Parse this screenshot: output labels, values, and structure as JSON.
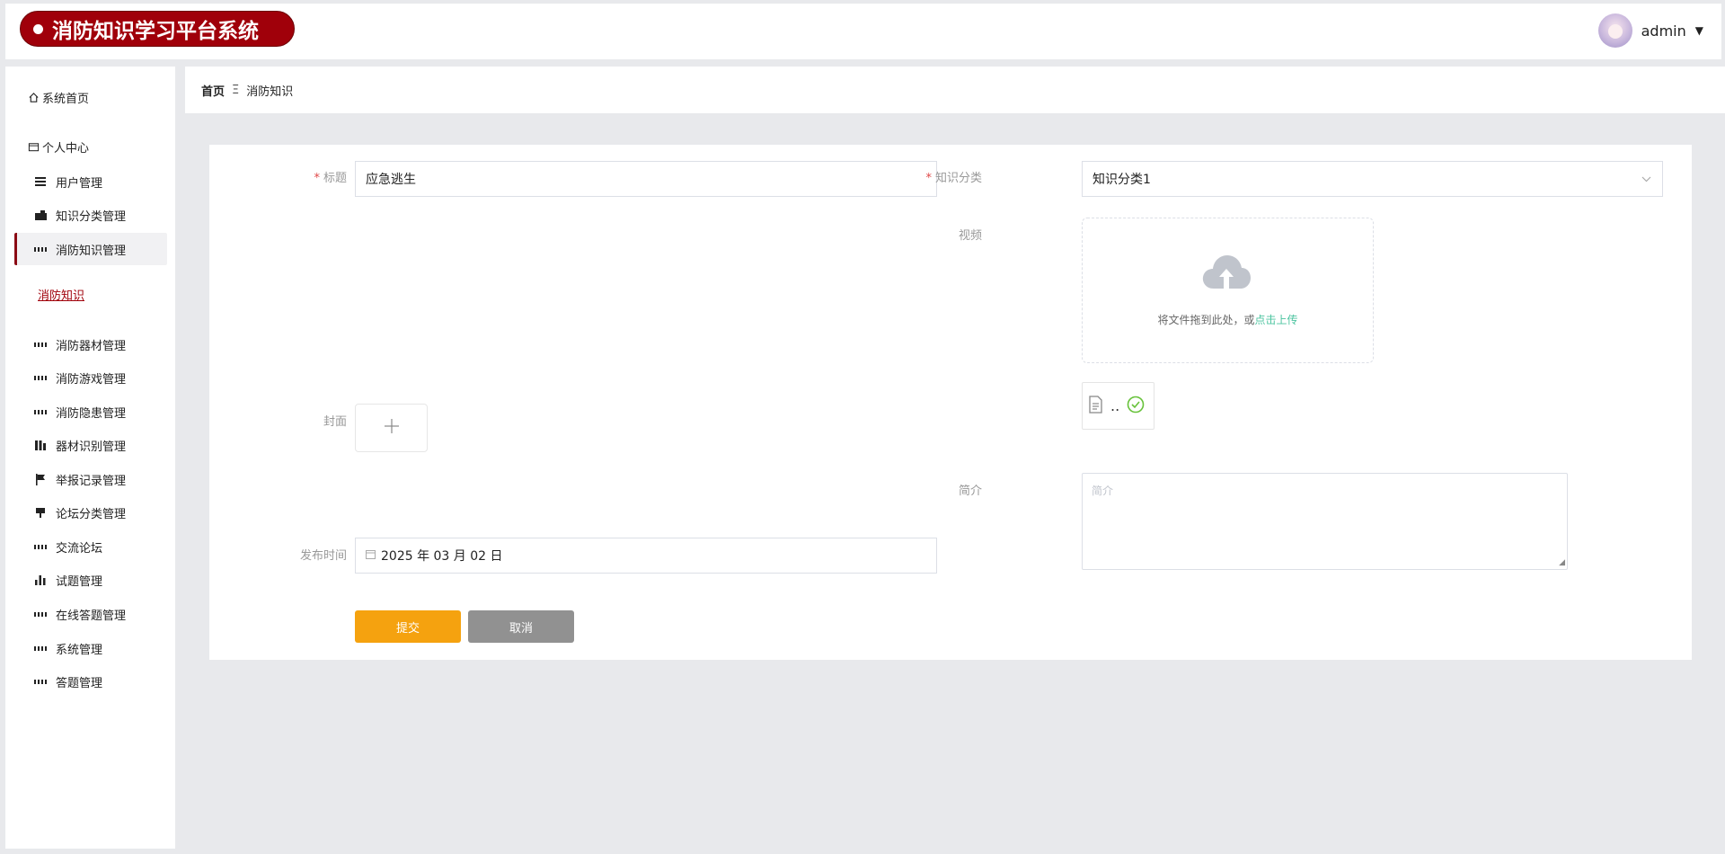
{
  "header": {
    "app_title": "消防知识学习平台系统",
    "username": "admin"
  },
  "sidebar": {
    "items": [
      {
        "label": "系统首页",
        "icon": "home-icon"
      },
      {
        "label": "个人中心",
        "icon": "card-icon"
      },
      {
        "label": "用户管理",
        "icon": "list-icon"
      },
      {
        "label": "知识分类管理",
        "icon": "folder-icon"
      },
      {
        "label": "消防知识管理",
        "icon": "grid-icon",
        "active": true
      },
      {
        "label": "消防知识",
        "child": true
      },
      {
        "label": "消防器材管理",
        "icon": "grid-icon"
      },
      {
        "label": "消防游戏管理",
        "icon": "grid-icon"
      },
      {
        "label": "消防隐患管理",
        "icon": "grid-icon"
      },
      {
        "label": "器材识别管理",
        "icon": "bars-icon"
      },
      {
        "label": "举报记录管理",
        "icon": "flag-icon"
      },
      {
        "label": "论坛分类管理",
        "icon": "tag-icon"
      },
      {
        "label": "交流论坛",
        "icon": "grid-icon"
      },
      {
        "label": "试题管理",
        "icon": "chart-icon"
      },
      {
        "label": "在线答题管理",
        "icon": "grid-icon"
      },
      {
        "label": "系统管理",
        "icon": "grid-icon"
      },
      {
        "label": "答题管理",
        "icon": "grid-icon"
      }
    ]
  },
  "breadcrumb": {
    "home": "首页",
    "separator": "Ξ",
    "current": "消防知识"
  },
  "form": {
    "title_label": "标题",
    "title_value": "应急逃生",
    "category_label": "知识分类",
    "category_value": "知识分类1",
    "video_label": "视频",
    "upload_text": "将文件拖到此处，或",
    "upload_link": "点击上传",
    "file_name": "..",
    "cover_label": "封面",
    "intro_label": "简介",
    "intro_placeholder": "简介",
    "publish_label": "发布时间",
    "publish_value": "2025 年 03 月 02 日",
    "submit_label": "提交",
    "cancel_label": "取消"
  },
  "colors": {
    "brand": "#a0000a",
    "submit": "#f5a20f",
    "cancel": "#919191",
    "upload_link": "#4cc4a0",
    "success": "#67c23a"
  }
}
